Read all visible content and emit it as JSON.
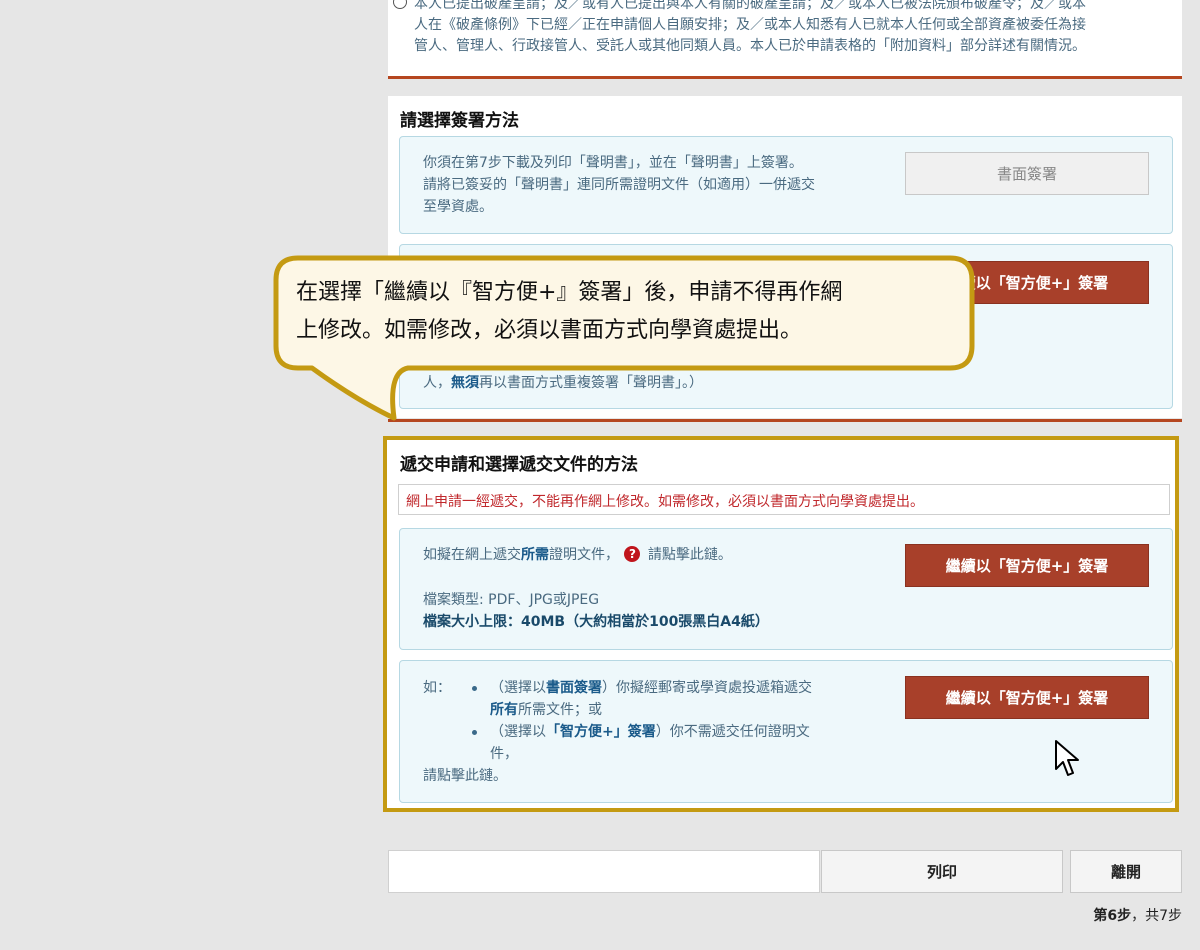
{
  "top_declaration": {
    "line1": "本人已提出破產呈請；及／或有人已提出與本人有關的破產呈請；及／或本人已被法院頒布破產令；及／或本",
    "line2": "人在《破產條例》下已經／正在申請個人自願安排；及／或本人知悉有人已就本人任何或全部資產被委任為接",
    "line3": "管人、管理人、行政接管人、受託人或其他同類人員。本人已於申請表格的「附加資料」部分詳述有關情況。"
  },
  "signing": {
    "title": "請選擇簽署方法",
    "paper_text_1": "你須在第7步下載及列印「聲明書」，並在「聲明書」上簽署。",
    "paper_text_2": "請將已簽妥的「聲明書」連同所需證明文件（如適用）一併遞交",
    "paper_text_3": "至學資處。",
    "paper_button": "書面簽署",
    "iam_button": "繼續以「智方便+」簽署",
    "iam_text_tail_1": "人，",
    "iam_text_tail_bold": "無須",
    "iam_text_tail_2": "再以書面方式重複簽署「聲明書」。）"
  },
  "callout": {
    "line1": "在選擇「繼續以『智方便+』簽署」後，申請不得再作網",
    "line2": "上修改。如需修改，必須以書面方式向學資處提出。"
  },
  "submit": {
    "title": "遞交申請和選擇遞交文件的方法",
    "warning": "網上申請一經遞交，不能再作網上修改。如需修改，必須以書面方式向學資處提出。",
    "box1": {
      "text_pre": "如擬在網上遞交",
      "text_bold": "所需",
      "text_post": "證明文件，",
      "text_after_icon": "請點擊此鏈。",
      "file_types": "檔案類型: PDF、JPG或JPEG",
      "size_limit": "檔案大小上限：40MB（大約相當於100張黑白A4紙）",
      "button": "繼續以「智方便+」簽署"
    },
    "box2": {
      "if_label": "如：",
      "bullet1_pre": "（選擇以",
      "bullet1_bold": "書面簽署",
      "bullet1_post": "）你擬經郵寄或學資處投遞箱遞交",
      "bullet1_line2_bold": "所有",
      "bullet1_line2_post": "所需文件；或",
      "bullet2_pre": "（選擇以",
      "bullet2_bold": "「智方便+」簽署",
      "bullet2_post": "）你不需遞交任何證明文",
      "bullet2_line2": "件，",
      "click_text": "請點擊此鏈。",
      "button": "繼續以「智方便+」簽署"
    }
  },
  "footer": {
    "print_button": "列印",
    "exit_button": "離開",
    "step_current": "第6步",
    "step_total": "共7步"
  },
  "colors": {
    "accent_red": "#a8402a",
    "highlight_gold": "#c49a12",
    "callout_fill": "#fdf7e6"
  }
}
